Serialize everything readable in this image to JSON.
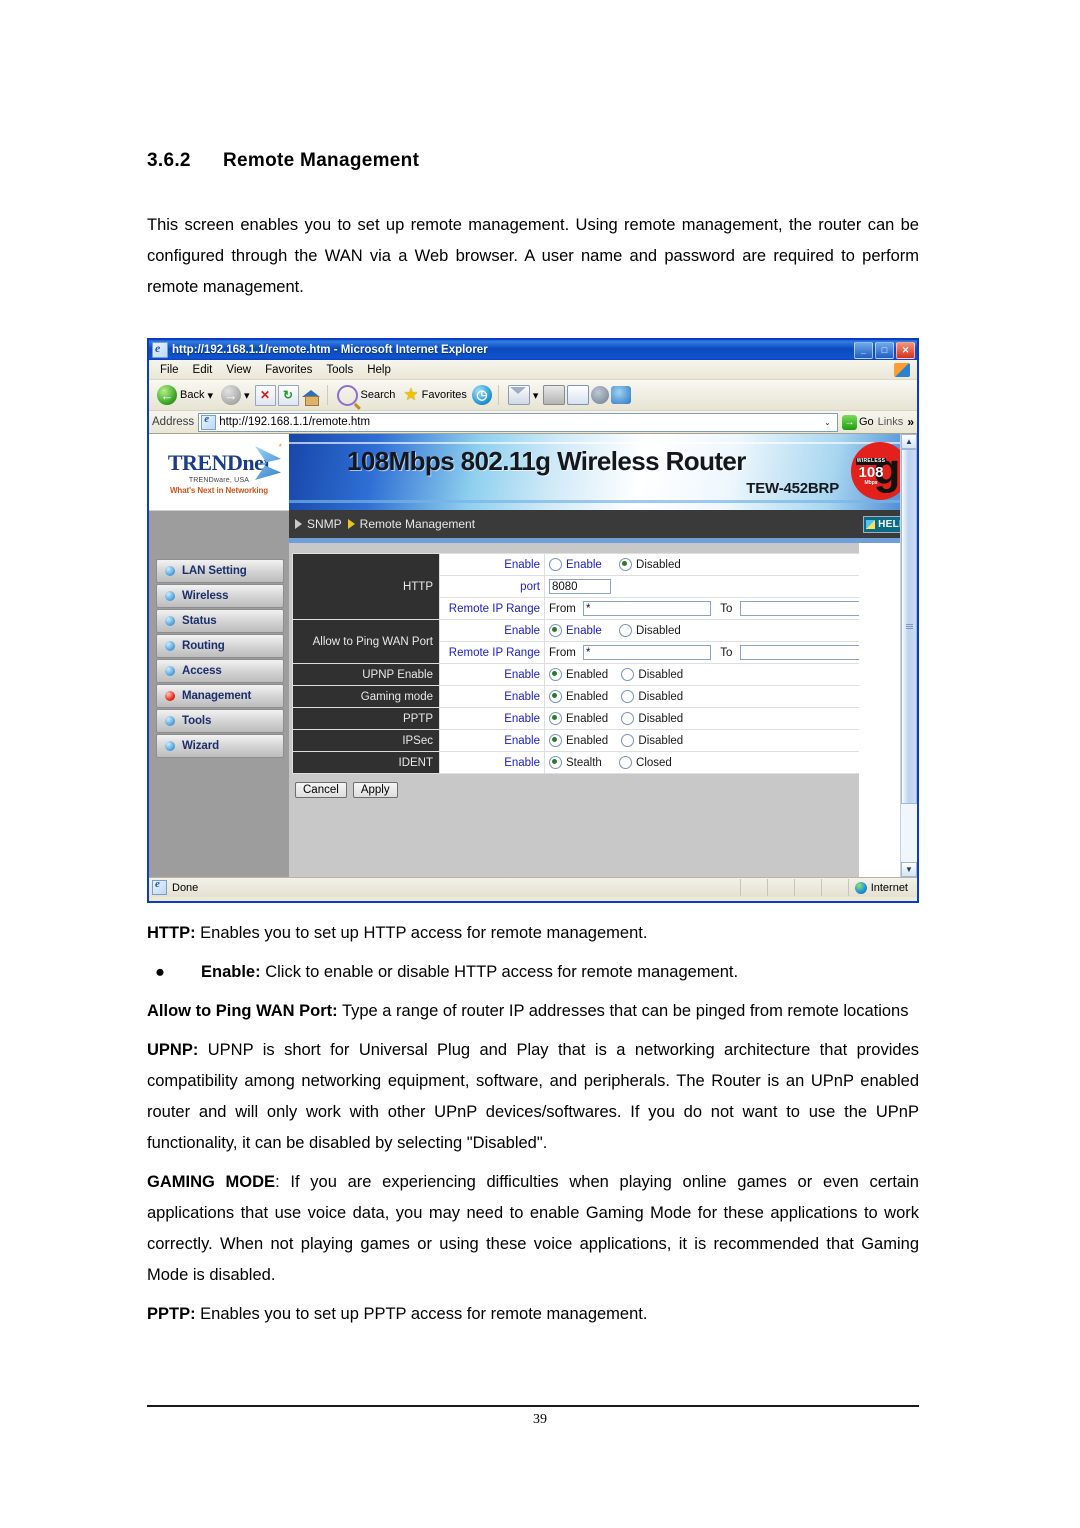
{
  "document": {
    "section_number": "3.6.2",
    "section_title": "Remote Management",
    "intro": "This screen enables you to set up remote management. Using remote management, the router can be configured through the WAN via a Web browser. A user name and password are required to perform remote management.",
    "notes": {
      "http_term": "HTTP:",
      "http_text": " Enables you to set up HTTP access for remote management.",
      "bullet_glyph": "●",
      "enable_term": "Enable:",
      "enable_text": " Click to enable or disable HTTP access for remote management.",
      "ping_term": "Allow to Ping WAN Port:",
      "ping_text": " Type a range of router IP addresses that can be pinged from remote locations",
      "upnp_term": "UPNP:",
      "upnp_text": " UPNP is short for Universal Plug and Play that is a networking architecture that provides compatibility among networking equipment, software, and peripherals. The Router is an UPnP enabled router and will only work with other UPnP devices/softwares. If you do not want to use the UPnP functionality, it can be disabled   by selecting \"Disabled\".",
      "gaming_term": "GAMING MODE",
      "gaming_text": ": If you are experiencing difficulties when playing online games or even certain applications that use voice data, you may need to enable Gaming Mode for these applications to work correctly. When not playing games or using these voice applications, it is recommended that Gaming Mode is disabled.",
      "pptp_term": "PPTP:",
      "pptp_text": " Enables you to set up PPTP access for remote management."
    },
    "page_number": "39"
  },
  "browser": {
    "title": "http://192.168.1.1/remote.htm - Microsoft Internet Explorer",
    "title_icon": "ie-page-icon",
    "window_buttons": {
      "minimize": "_",
      "maximize": "□",
      "close": "✕"
    },
    "menu": [
      {
        "label": "File",
        "accel": "F"
      },
      {
        "label": "Edit",
        "accel": "E"
      },
      {
        "label": "View",
        "accel": "V"
      },
      {
        "label": "Favorites",
        "accel": "a"
      },
      {
        "label": "Tools",
        "accel": "T"
      },
      {
        "label": "Help",
        "accel": "H"
      }
    ],
    "toolbar": {
      "back_label": "Back",
      "back_dropdown": "▾",
      "forward_dropdown": "▾",
      "stop_glyph": "✕",
      "refresh_glyph": "↻",
      "home_label": "home-icon",
      "search_label": "Search",
      "favorites_label": "Favorites",
      "history_glyph": "◷",
      "mail_label": "mail-icon",
      "mail_dropdown": "▾",
      "print_label": "print-icon",
      "edit_label": "edit-icon",
      "discuss_label": "discuss-icon",
      "messenger_label": "messenger-icon"
    },
    "address": {
      "label": "Address",
      "value": "http://192.168.1.1/remote.htm",
      "dropdown_glyph": "⌄",
      "go_label": "Go",
      "go_glyph": "→",
      "links_label": "Links",
      "chevron": "»"
    },
    "status": {
      "text": "Done",
      "zone": "Internet"
    },
    "scrollbar": {
      "up_glyph": "▲",
      "down_glyph": "▼"
    }
  },
  "router": {
    "logo": {
      "brand_main": "TRENDnet",
      "brand_sub": "TRENDware, USA",
      "brand_tag": "What's Next in Networking",
      "trademark": "*"
    },
    "banner": {
      "title": "108Mbps 802.11g Wireless Router",
      "model": "TEW-452BRP",
      "badge_wireless": "WIRELESS",
      "badge_number": "108",
      "badge_unit": "Mbps",
      "badge_g": "g"
    },
    "breadcrumb": {
      "first": "SNMP",
      "second": "Remote Management"
    },
    "help_label": "HELP",
    "sidebar": [
      {
        "label": "LAN Setting",
        "active": false
      },
      {
        "label": "Wireless",
        "active": false
      },
      {
        "label": "Status",
        "active": false
      },
      {
        "label": "Routing",
        "active": false
      },
      {
        "label": "Access",
        "active": false
      },
      {
        "label": "Management",
        "active": true
      },
      {
        "label": "Tools",
        "active": false
      },
      {
        "label": "Wizard",
        "active": false
      }
    ],
    "form": {
      "http": {
        "category": "HTTP",
        "enable_label": "Enable",
        "enable_option": "Enable",
        "disabled_option": "Disabled",
        "enable_selected": "Disabled",
        "port_label": "port",
        "port_value": "8080",
        "range_label": "Remote IP Range",
        "from_label": "From",
        "from_value": "*",
        "to_label": "To",
        "to_value": ""
      },
      "ping": {
        "category": "Allow to Ping WAN Port",
        "enable_label": "Enable",
        "enable_option": "Enable",
        "disabled_option": "Disabled",
        "enable_selected": "Enable",
        "range_label": "Remote IP Range",
        "from_label": "From",
        "from_value": "*",
        "to_label": "To",
        "to_value": ""
      },
      "simple_rows": [
        {
          "category": "UPNP Enable",
          "label": "Enable",
          "opt_a": "Enabled",
          "opt_b": "Disabled",
          "selected": "Enabled"
        },
        {
          "category": "Gaming mode",
          "label": "Enable",
          "opt_a": "Enabled",
          "opt_b": "Disabled",
          "selected": "Enabled"
        },
        {
          "category": "PPTP",
          "label": "Enable",
          "opt_a": "Enabled",
          "opt_b": "Disabled",
          "selected": "Enabled"
        },
        {
          "category": "IPSec",
          "label": "Enable",
          "opt_a": "Enabled",
          "opt_b": "Disabled",
          "selected": "Enabled"
        },
        {
          "category": "IDENT",
          "label": "Enable",
          "opt_a": "Stealth",
          "opt_b": "Closed",
          "selected": "Stealth"
        }
      ],
      "cancel_label": "Cancel",
      "apply_label": "Apply"
    }
  },
  "colors": {
    "title_bar": "#0a3cc8",
    "link_blue": "#1a1ad0",
    "category_bg": "#303030",
    "brand_blue": "#1b3c8c",
    "brand_orange": "#d2521a",
    "badge_red": "#e2201c"
  }
}
